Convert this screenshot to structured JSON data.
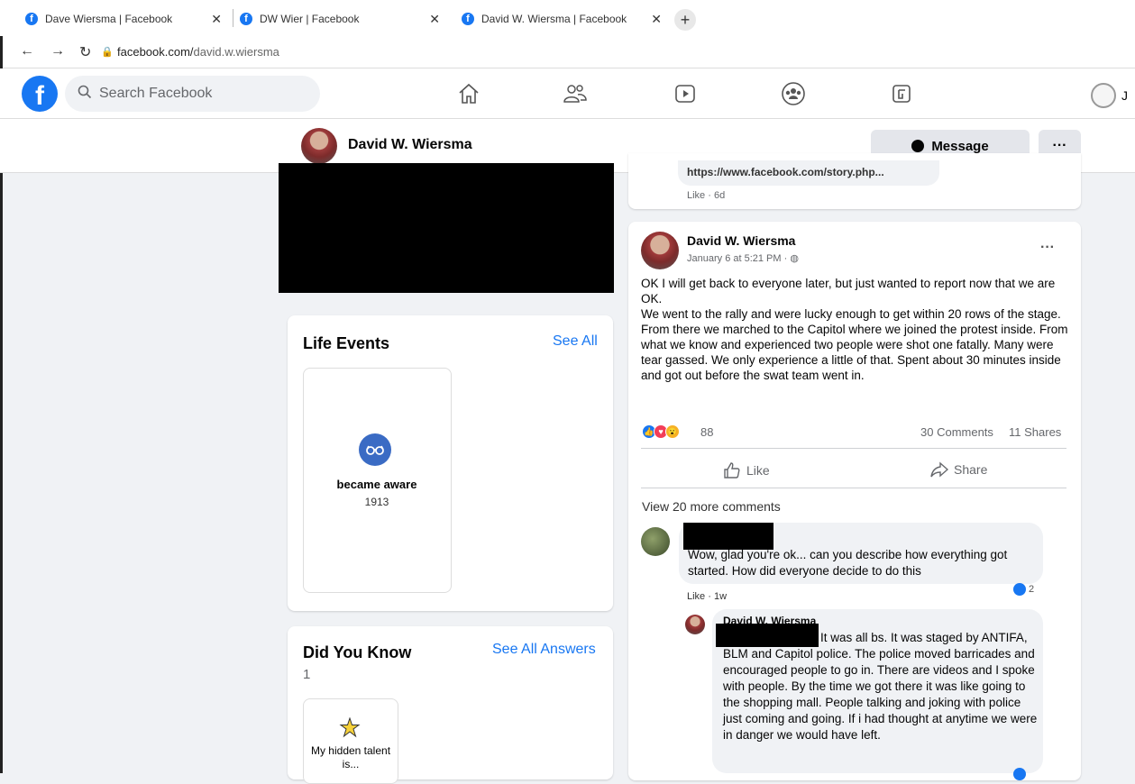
{
  "browser": {
    "tabs": [
      {
        "title": "Dave Wiersma | Facebook"
      },
      {
        "title": "DW Wier | Facebook"
      },
      {
        "title": "David W. Wiersma | Facebook"
      }
    ],
    "url_domain": "facebook.com/",
    "url_path": "david.w.wiersma"
  },
  "fb_header": {
    "search_placeholder": "Search Facebook",
    "account_initial": "J"
  },
  "profile_bar": {
    "name": "David W. Wiersma",
    "message_label": "Message",
    "more_label": "···"
  },
  "life_events": {
    "title": "Life Events",
    "see_all": "See All",
    "event_label": "became aware",
    "event_year": "1913"
  },
  "did_you_know": {
    "title": "Did You Know",
    "count": "1",
    "see_all": "See All Answers",
    "prompt": "My hidden talent is..."
  },
  "prev_post": {
    "link_text": "https://www.facebook.com/story.php...",
    "meta": "Like · 6d"
  },
  "post": {
    "author": "David W. Wiersma",
    "date": "January 6 at 5:21 PM · ",
    "more": "···",
    "body_p1": "OK I will get back to everyone later, but just wanted to report now that we are OK.",
    "body_p2": "We went to the rally and were lucky enough to get within 20 rows of the stage. From there we marched to the Capitol where we joined the protest inside. From what we know and experienced two people were shot one fatally. Many were tear gassed. We only experience a little of that. Spent about 30 minutes inside and got out before the swat team went in.",
    "reaction_count": "88",
    "comments": "30 Comments",
    "shares": "11 Shares",
    "like_label": "Like",
    "share_label": "Share",
    "view_more": "View 20 more comments"
  },
  "comment1": {
    "text": "Wow, glad you're ok... can you describe how everything got started. How did everyone decide to do this",
    "meta": "Like · 1w",
    "reactions": "2"
  },
  "comment2": {
    "author": "David W. Wiersma",
    "text": "It was all bs. It was staged by ANTIFA, BLM and Capitol police. The police moved barricades and encouraged people to go in. There are videos and I spoke with people. By the time we got there it was like going to the shopping mall. People talking and joking with police just coming and going. If i had thought at anytime we were in danger we would have left."
  },
  "colors": {
    "fb_blue": "#1877f2",
    "bg": "#f0f2f5",
    "secondary_text": "#65676b"
  },
  "icons": [
    "facebook-icon",
    "search-icon",
    "home-icon",
    "friends-icon",
    "watch-icon",
    "groups-icon",
    "gaming-icon",
    "messenger-icon",
    "like-icon",
    "share-icon",
    "globe-icon"
  ]
}
